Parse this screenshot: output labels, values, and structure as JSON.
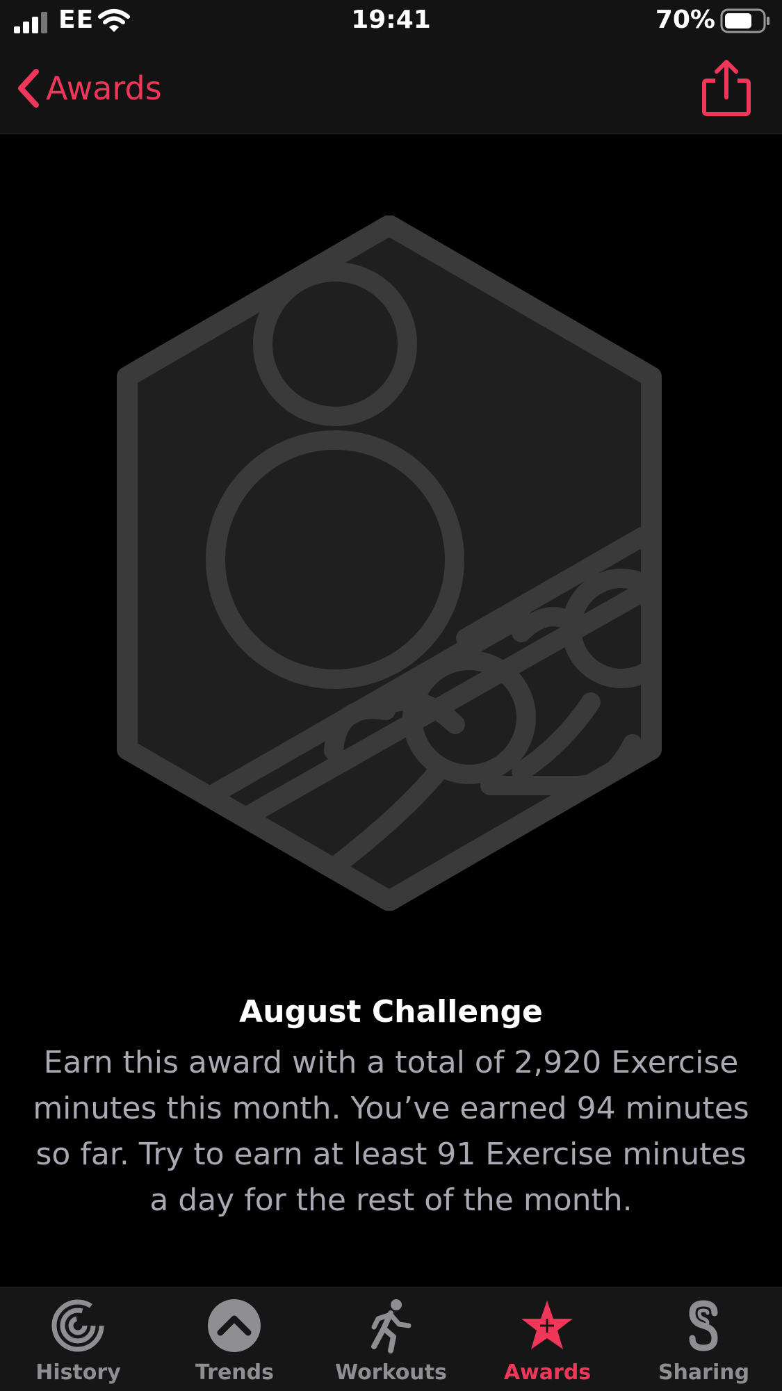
{
  "status_bar": {
    "carrier": "EE",
    "time": "19:41",
    "battery": "70%"
  },
  "nav": {
    "back_label": "Awards",
    "back_icon": "chevron-left-icon",
    "share_icon": "share-icon"
  },
  "award": {
    "title": "August Challenge",
    "description": "Earn this award with a total of 2,920 Exercise minutes this month. You’ve earned 94 minutes so far. Try to earn at least 91 Exercise minutes a day for the rest of the month."
  },
  "tabs": [
    {
      "label": "History",
      "icon": "history-icon",
      "active": false
    },
    {
      "label": "Trends",
      "icon": "trends-icon",
      "active": false
    },
    {
      "label": "Workouts",
      "icon": "workouts-icon",
      "active": false
    },
    {
      "label": "Awards",
      "icon": "awards-icon",
      "active": true
    },
    {
      "label": "Sharing",
      "icon": "sharing-icon",
      "active": false
    }
  ],
  "colors": {
    "accent": "#f0375a",
    "background": "#000000",
    "badge_fill": "#1f1f1f",
    "badge_stroke": "#3a3a3a",
    "inactive_tab": "#8e8e93"
  }
}
